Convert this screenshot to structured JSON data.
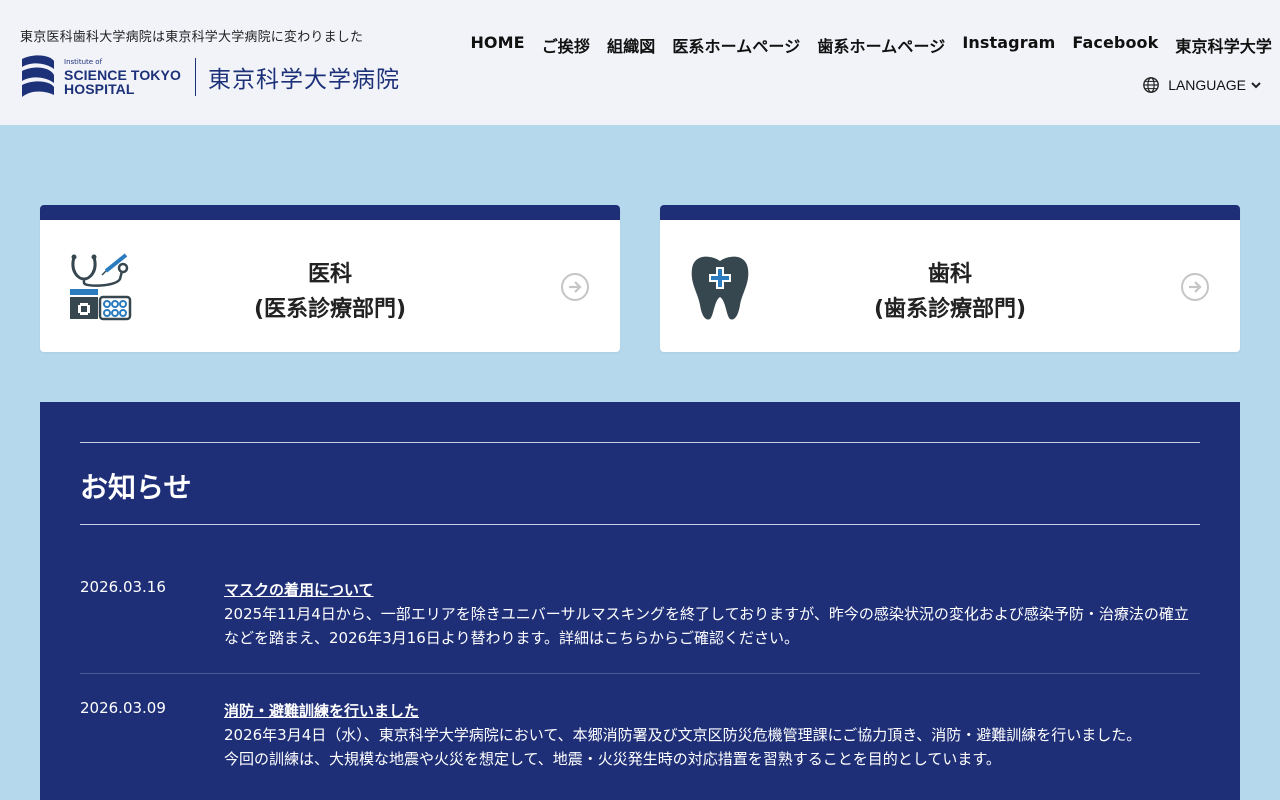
{
  "header": {
    "notice": "東京医科歯科大学病院は東京科学大学病院に変わりました",
    "logo": {
      "en_small": "Institute of",
      "en_line1": "SCIENCE TOKYO",
      "en_line2": "HOSPITAL",
      "jp": "東京科学大学病院"
    },
    "nav": [
      "HOME",
      "ご挨拶",
      "組織図",
      "医系ホームページ",
      "歯系ホームページ",
      "Instagram",
      "Facebook",
      "東京科学大学"
    ],
    "language": "LANGUAGE"
  },
  "cards": [
    {
      "line1": "医科",
      "line2": "(医系診療部門)",
      "icon": "medical-icon"
    },
    {
      "line1": "歯科",
      "line2": "(歯系診療部門)",
      "icon": "tooth-icon"
    }
  ],
  "news": {
    "heading": "お知らせ",
    "items": [
      {
        "date": "2026.03.16",
        "title": "マスクの着用について",
        "text": "2025年11月4日から、一部エリアを除きユニバーサルマスキングを終了しておりますが、昨今の感染状況の変化および感染予防・治療法の確立などを踏まえ、2026年3月16日より替わります。詳細はこちらからご確認ください。"
      },
      {
        "date": "2026.03.09",
        "title": "消防・避難訓練を行いました",
        "text": "2026年3月4日（水）、東京科学大学病院において、本郷消防署及び文京区防災危機管理課にご協力頂き、消防・避難訓練を行いました。",
        "text2": "今回の訓練は、大規模な地震や火災を想定して、地震・火災発生時の対応措置を習熟することを目的としています。"
      }
    ]
  },
  "colors": {
    "navy": "#1e2f77",
    "header_bg": "#f1f3f9",
    "page_bg": "#b5d8ec"
  }
}
